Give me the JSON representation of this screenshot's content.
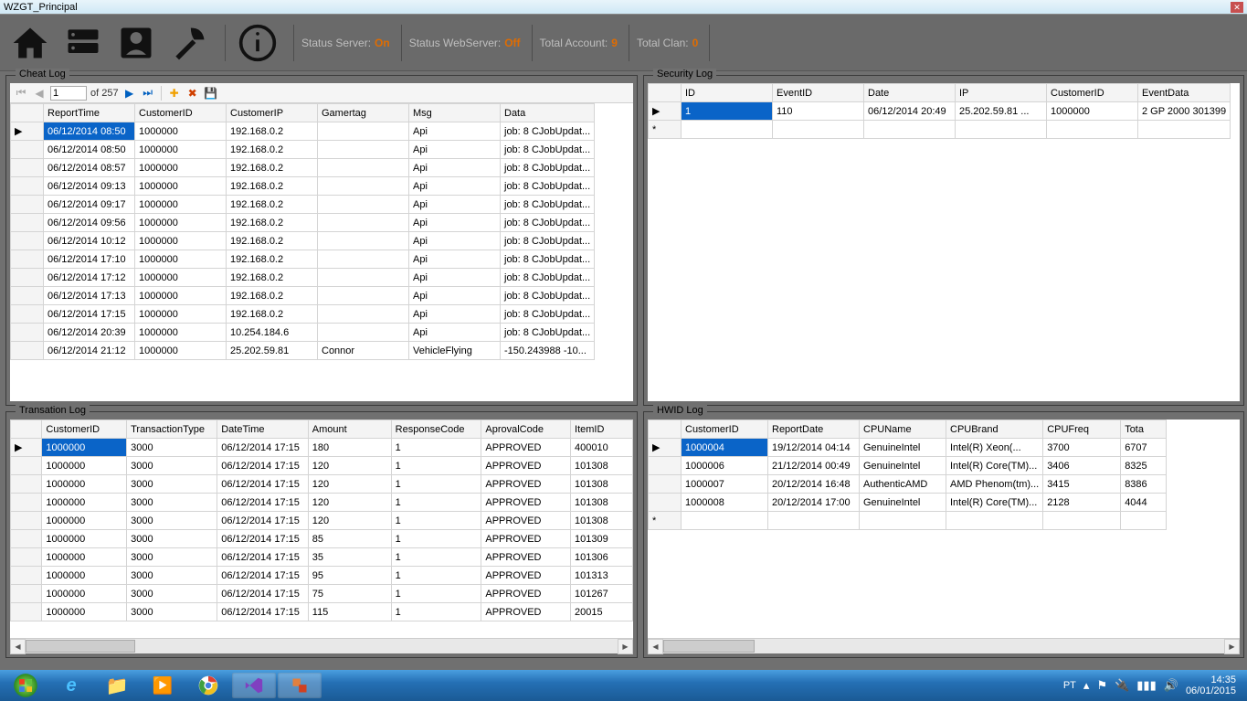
{
  "window": {
    "title": "WZGT_Principal"
  },
  "status": {
    "server_label": "Status Server:",
    "server_value": "On",
    "webserver_label": "Status WebServer:",
    "webserver_value": "Off",
    "account_label": "Total Account:",
    "account_value": "9",
    "clan_label": "Total Clan:",
    "clan_value": "0"
  },
  "nav": {
    "current": "1",
    "of_label": "of 257"
  },
  "panels": {
    "cheat": {
      "title": "Cheat Log",
      "headers": [
        "ReportTime",
        "CustomerID",
        "CustomerIP",
        "Gamertag",
        "Msg",
        "Data"
      ],
      "widths": [
        100,
        100,
        100,
        100,
        100,
        100
      ],
      "rows": [
        [
          "06/12/2014 08:50",
          "1000000",
          "192.168.0.2",
          "",
          "Api",
          "job: 8 CJobUpdat..."
        ],
        [
          "06/12/2014 08:50",
          "1000000",
          "192.168.0.2",
          "",
          "Api",
          "job: 8 CJobUpdat..."
        ],
        [
          "06/12/2014 08:57",
          "1000000",
          "192.168.0.2",
          "",
          "Api",
          "job: 8 CJobUpdat..."
        ],
        [
          "06/12/2014 09:13",
          "1000000",
          "192.168.0.2",
          "",
          "Api",
          "job: 8 CJobUpdat..."
        ],
        [
          "06/12/2014 09:17",
          "1000000",
          "192.168.0.2",
          "",
          "Api",
          "job: 8 CJobUpdat..."
        ],
        [
          "06/12/2014 09:56",
          "1000000",
          "192.168.0.2",
          "",
          "Api",
          "job: 8 CJobUpdat..."
        ],
        [
          "06/12/2014 10:12",
          "1000000",
          "192.168.0.2",
          "",
          "Api",
          "job: 8 CJobUpdat..."
        ],
        [
          "06/12/2014 17:10",
          "1000000",
          "192.168.0.2",
          "",
          "Api",
          "job: 8 CJobUpdat..."
        ],
        [
          "06/12/2014 17:12",
          "1000000",
          "192.168.0.2",
          "",
          "Api",
          "job: 8 CJobUpdat..."
        ],
        [
          "06/12/2014 17:13",
          "1000000",
          "192.168.0.2",
          "",
          "Api",
          "job: 8 CJobUpdat..."
        ],
        [
          "06/12/2014 17:15",
          "1000000",
          "192.168.0.2",
          "",
          "Api",
          "job: 8 CJobUpdat..."
        ],
        [
          "06/12/2014 20:39",
          "1000000",
          "10.254.184.6",
          "",
          "Api",
          "job: 8 CJobUpdat..."
        ],
        [
          "06/12/2014 21:12",
          "1000000",
          "25.202.59.81",
          "Connor",
          "VehicleFlying",
          "-150.243988 -10..."
        ]
      ],
      "selected_row": 0,
      "row_marker": "▶"
    },
    "security": {
      "title": "Security Log",
      "headers": [
        "ID",
        "EventID",
        "Date",
        "IP",
        "CustomerID",
        "EventData"
      ],
      "widths": [
        100,
        100,
        100,
        100,
        100,
        100
      ],
      "rows": [
        [
          "1",
          "110",
          "06/12/2014 20:49",
          "25.202.59.81   ...",
          "1000000",
          "2 GP 2000 301399"
        ]
      ],
      "selected_row": 0,
      "star_row": true,
      "row_marker": "▶"
    },
    "transaction": {
      "title": "Transation Log",
      "headers": [
        "CustomerID",
        "TransactionType",
        "DateTime",
        "Amount",
        "ResponseCode",
        "AprovalCode",
        "ItemID"
      ],
      "widths": [
        95,
        100,
        100,
        95,
        100,
        100,
        70
      ],
      "rows": [
        [
          "1000000",
          "3000",
          "06/12/2014 17:15",
          "180",
          "1",
          "APPROVED",
          "400010"
        ],
        [
          "1000000",
          "3000",
          "06/12/2014 17:15",
          "120",
          "1",
          "APPROVED",
          "101308"
        ],
        [
          "1000000",
          "3000",
          "06/12/2014 17:15",
          "120",
          "1",
          "APPROVED",
          "101308"
        ],
        [
          "1000000",
          "3000",
          "06/12/2014 17:15",
          "120",
          "1",
          "APPROVED",
          "101308"
        ],
        [
          "1000000",
          "3000",
          "06/12/2014 17:15",
          "120",
          "1",
          "APPROVED",
          "101308"
        ],
        [
          "1000000",
          "3000",
          "06/12/2014 17:15",
          "85",
          "1",
          "APPROVED",
          "101309"
        ],
        [
          "1000000",
          "3000",
          "06/12/2014 17:15",
          "35",
          "1",
          "APPROVED",
          "101306"
        ],
        [
          "1000000",
          "3000",
          "06/12/2014 17:15",
          "95",
          "1",
          "APPROVED",
          "101313"
        ],
        [
          "1000000",
          "3000",
          "06/12/2014 17:15",
          "75",
          "1",
          "APPROVED",
          "101267"
        ],
        [
          "1000000",
          "3000",
          "06/12/2014 17:15",
          "115",
          "1",
          "APPROVED",
          "20015"
        ]
      ],
      "selected_row": 0,
      "row_marker": "▶"
    },
    "hwid": {
      "title": "HWID Log",
      "headers": [
        "CustomerID",
        "ReportDate",
        "CPUName",
        "CPUBrand",
        "CPUFreq",
        "Tota"
      ],
      "widths": [
        95,
        100,
        95,
        100,
        85,
        50
      ],
      "rows": [
        [
          "1000004",
          "19/12/2014 04:14",
          "GenuineIntel",
          "        Intel(R) Xeon(...",
          "3700",
          "6707"
        ],
        [
          "1000006",
          "21/12/2014 00:49",
          "GenuineIntel",
          "Intel(R) Core(TM)...",
          "3406",
          "8325"
        ],
        [
          "1000007",
          "20/12/2014 16:48",
          "AuthenticAMD",
          "AMD Phenom(tm)...",
          "3415",
          "8386"
        ],
        [
          "1000008",
          "20/12/2014 17:00",
          "GenuineIntel",
          "Intel(R) Core(TM)...",
          "2128",
          "4044"
        ]
      ],
      "selected_row": 0,
      "star_row": true,
      "row_marker": "▶"
    }
  },
  "taskbar": {
    "lang": "PT",
    "time": "14:35",
    "date": "06/01/2015"
  }
}
